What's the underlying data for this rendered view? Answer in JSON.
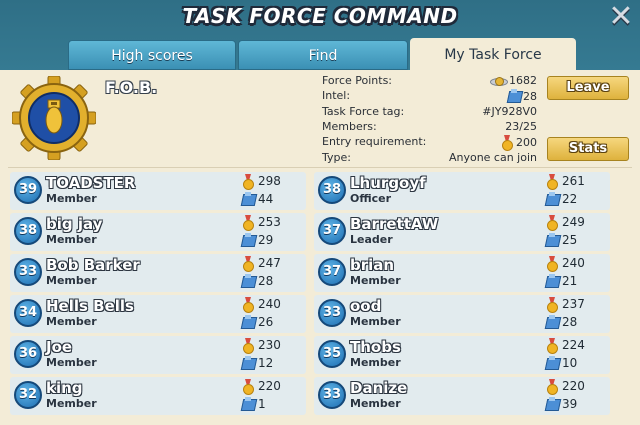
{
  "header": {
    "title": "TASK FORCE COMMAND",
    "close_glyph": "✕"
  },
  "tabs": [
    {
      "label": "High scores",
      "active": false
    },
    {
      "label": "Find",
      "active": false
    },
    {
      "label": "My Task Force",
      "active": true
    }
  ],
  "task_force": {
    "name": "F.O.B.",
    "badge_icon": "bomb-badge-icon",
    "info": {
      "force_points_label": "Force Points:",
      "force_points_value": "1682",
      "intel_label": "Intel:",
      "intel_value": "28",
      "tag_label": "Task Force tag:",
      "tag_value": "#JY928V0",
      "members_label": "Members:",
      "members_value": "23/25",
      "entry_label": "Entry requirement:",
      "entry_value": "200",
      "type_label": "Type:",
      "type_value": "Anyone can join"
    },
    "leave_label": "Leave",
    "stats_label": "Stats"
  },
  "members_left": [
    {
      "level": "39",
      "name": "TOADSTER",
      "role": "Member",
      "medals": "298",
      "intel": "44"
    },
    {
      "level": "38",
      "name": "big jay",
      "role": "Member",
      "medals": "253",
      "intel": "29"
    },
    {
      "level": "33",
      "name": "Bob Barker",
      "role": "Member",
      "medals": "247",
      "intel": "28"
    },
    {
      "level": "34",
      "name": "Hells Bells",
      "role": "Member",
      "medals": "240",
      "intel": "26"
    },
    {
      "level": "36",
      "name": "Joe",
      "role": "Member",
      "medals": "230",
      "intel": "12"
    },
    {
      "level": "32",
      "name": "king",
      "role": "Member",
      "medals": "220",
      "intel": "1"
    }
  ],
  "members_right": [
    {
      "level": "38",
      "name": "Lhurgoyf",
      "role": "Officer",
      "medals": "261",
      "intel": "22"
    },
    {
      "level": "37",
      "name": "BarrettAW",
      "role": "Leader",
      "medals": "249",
      "intel": "25"
    },
    {
      "level": "37",
      "name": "brian",
      "role": "Member",
      "medals": "240",
      "intel": "21"
    },
    {
      "level": "33",
      "name": "ood",
      "role": "Member",
      "medals": "237",
      "intel": "28"
    },
    {
      "level": "35",
      "name": "Thobs",
      "role": "Member",
      "medals": "224",
      "intel": "10"
    },
    {
      "level": "33",
      "name": "Danize",
      "role": "Member",
      "medals": "220",
      "intel": "39"
    }
  ]
}
